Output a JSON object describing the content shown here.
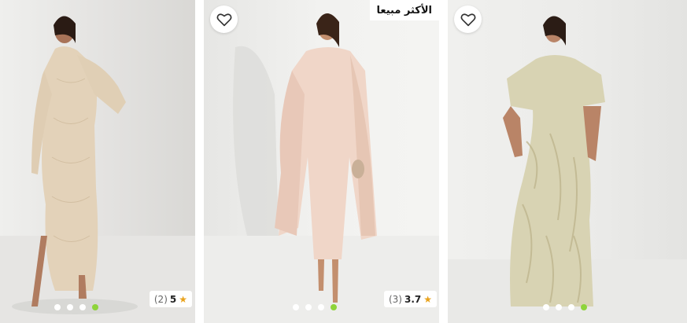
{
  "products": [
    {
      "badge": "",
      "rating": {
        "score": "5",
        "count": "(2)"
      },
      "dots": 4,
      "active_dot": 3,
      "bg": "#e9e8e6",
      "dress_color": "#e3d2b9"
    },
    {
      "badge": "الأكثر مبيعا",
      "rating": {
        "score": "3.7",
        "count": "(3)"
      },
      "dots": 4,
      "active_dot": 3,
      "bg": "#f1f1ef",
      "dress_color": "#f0d6c8"
    },
    {
      "badge": "",
      "rating": null,
      "dots": 4,
      "active_dot": 3,
      "bg": "#eeeeec",
      "dress_color": "#d8d3b3"
    }
  ],
  "icons": {
    "wishlist": "heart-outline-icon",
    "star": "star-icon"
  },
  "colors": {
    "accent_dot": "#8ed43a",
    "star": "#e9a21b"
  }
}
